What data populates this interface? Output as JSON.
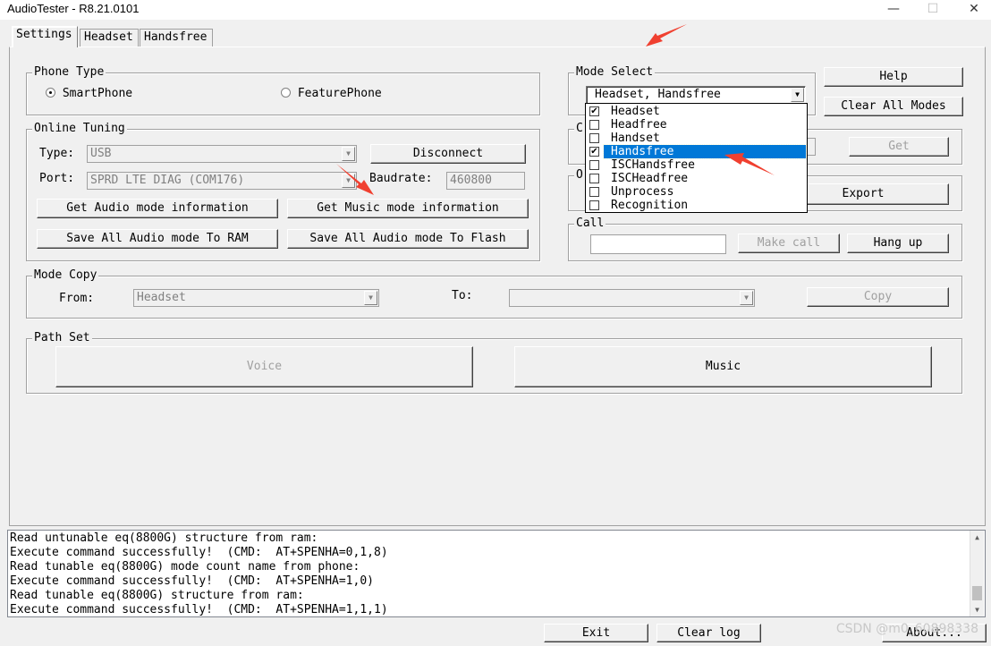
{
  "window": {
    "title": "AudioTester - R8.21.0101",
    "minimize": "—",
    "maximize": "☐",
    "close": "✕"
  },
  "tabs": [
    "Settings",
    "Headset",
    "Handsfree"
  ],
  "phone_type": {
    "title": "Phone Type",
    "option1": "SmartPhone",
    "option2": "FeaturePhone",
    "selected": "SmartPhone"
  },
  "online_tuning": {
    "title": "Online Tuning",
    "type_label": "Type:",
    "type_value": "USB",
    "port_label": "Port:",
    "port_value": "SPRD LTE DIAG (COM176)",
    "baudrate_label": "Baudrate:",
    "baudrate_value": "460800",
    "disconnect": "Disconnect",
    "get_audio": "Get Audio mode information",
    "get_music": "Get Music mode information",
    "save_ram": "Save All Audio mode To RAM",
    "save_flash": "Save All Audio mode To Flash"
  },
  "mode_select": {
    "title": "Mode Select",
    "value": "Headset, Handsfree",
    "items": [
      {
        "label": "Headset",
        "checked": true
      },
      {
        "label": "Headfree",
        "checked": false
      },
      {
        "label": "Handset",
        "checked": false
      },
      {
        "label": "Handsfree",
        "checked": true
      },
      {
        "label": "ISCHandsfree",
        "checked": false
      },
      {
        "label": "ISCHeadfree",
        "checked": false
      },
      {
        "label": "Unprocess",
        "checked": false
      },
      {
        "label": "Recognition",
        "checked": false
      }
    ],
    "highlighted": "Handsfree",
    "hidden_group1_title": "C",
    "hidden_group2_title": "O"
  },
  "right_buttons": {
    "help": "Help",
    "clear_all": "Clear All Modes",
    "get": "Get",
    "export": "Export"
  },
  "call": {
    "title": "Call",
    "input_value": "",
    "make_call": "Make call",
    "hang_up": "Hang up"
  },
  "mode_copy": {
    "title": "Mode Copy",
    "from_label": "From:",
    "from_value": "Headset",
    "to_label": "To:",
    "to_value": "",
    "copy": "Copy"
  },
  "path_set": {
    "title": "Path Set",
    "voice": "Voice",
    "music": "Music"
  },
  "log": [
    "Read untunable eq(8800G) structure from ram:",
    "Execute command successfully!  (CMD:  AT+SPENHA=0,1,8)",
    "Read tunable eq(8800G) mode count name from phone:",
    "Execute command successfully!  (CMD:  AT+SPENHA=1,0)",
    "Read tunable eq(8800G) structure from ram:",
    "Execute command successfully!  (CMD:  AT+SPENHA=1,1,1)"
  ],
  "bottom": {
    "exit": "Exit",
    "clear_log": "Clear log",
    "about": "About..."
  },
  "watermark": "CSDN @m0_60898338",
  "colors": {
    "accent": "#0078d7",
    "annotation_arrow": "#f04030"
  }
}
